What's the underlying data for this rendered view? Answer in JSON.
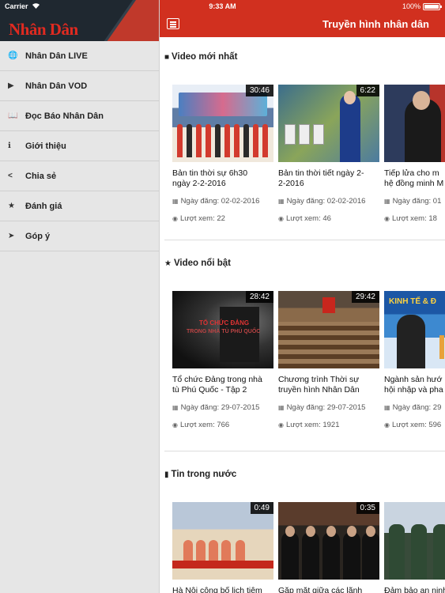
{
  "status_bar": {
    "carrier": "Carrier",
    "time": "9:33 AM",
    "battery": "100%"
  },
  "sidebar": {
    "logo": "Nhân Dân",
    "items": [
      {
        "label": "Nhân Dân LIVE",
        "icon": "globe-icon",
        "glyph": "🌐"
      },
      {
        "label": "Nhân Dân VOD",
        "icon": "youtube-icon",
        "glyph": "▶"
      },
      {
        "label": "Đọc Báo Nhân Dân",
        "icon": "book-icon",
        "glyph": "📖"
      },
      {
        "label": "Giới thiệu",
        "icon": "info-icon",
        "glyph": "ℹ"
      },
      {
        "label": "Chia sẻ",
        "icon": "share-icon",
        "glyph": "<"
      },
      {
        "label": "Đánh giá",
        "icon": "star-icon",
        "glyph": "★"
      },
      {
        "label": "Góp ý",
        "icon": "send-icon",
        "glyph": "➤"
      }
    ]
  },
  "header": {
    "title": "Truyền hình nhân dân"
  },
  "sections": [
    {
      "title": "Video mới nhất",
      "icon": "video-camera-icon",
      "videos": [
        {
          "duration": "30:46",
          "title_lines": [
            "Bản tin thời sự 6h30",
            "ngày 2-2-2016"
          ],
          "date": "Ngày đăng: 02-02-2016",
          "views": "Lượt xem: 22"
        },
        {
          "duration": "6:22",
          "title_lines": [
            "Bản tin thời tiết ngày 2-",
            "2-2016"
          ],
          "date": "Ngày đăng: 02-02-2016",
          "views": "Lượt xem: 46"
        },
        {
          "duration": "",
          "title_lines": [
            "Tiếp lửa cho m",
            "hệ đồng minh M"
          ],
          "date": "Ngày đăng: 01",
          "views": "Lượt xem: 18"
        }
      ]
    },
    {
      "title": "Video nổi bật",
      "icon": "star-icon",
      "videos": [
        {
          "duration": "28:42",
          "title_lines": [
            "Tổ chức Đảng trong nhà",
            "tù Phú Quốc - Tập 2"
          ],
          "date": "Ngày đăng: 29-07-2015",
          "views": "Lượt xem: 766"
        },
        {
          "duration": "29:42",
          "title_lines": [
            "Chương trình Thời sự",
            "truyền hình Nhân Dân"
          ],
          "date": "Ngày đăng: 29-07-2015",
          "views": "Lượt xem: 1921"
        },
        {
          "duration": "",
          "title_lines": [
            "Ngành sản hướ",
            "hội nhập và pha"
          ],
          "date": "Ngày đăng: 29",
          "views": "Lượt xem: 596"
        }
      ]
    },
    {
      "title": "Tin trong nước",
      "icon": "bookmark-icon",
      "videos": [
        {
          "duration": "0:49",
          "title_lines": [
            "Hà Nội công bố lịch tiêm"
          ],
          "date": "",
          "views": ""
        },
        {
          "duration": "0:35",
          "title_lines": [
            "Gặp mặt giữa các lãnh"
          ],
          "date": "",
          "views": ""
        },
        {
          "duration": "",
          "title_lines": [
            "Đảm bảo an ninh"
          ],
          "date": "",
          "views": ""
        }
      ]
    }
  ],
  "thumb_texts": {
    "prison_line1": "TỔ CHỨC ĐẢNG",
    "prison_line2": "TRONG NHÀ TÙ PHÚ QUỐC",
    "econ_label": "KINH TẾ & Đ"
  }
}
